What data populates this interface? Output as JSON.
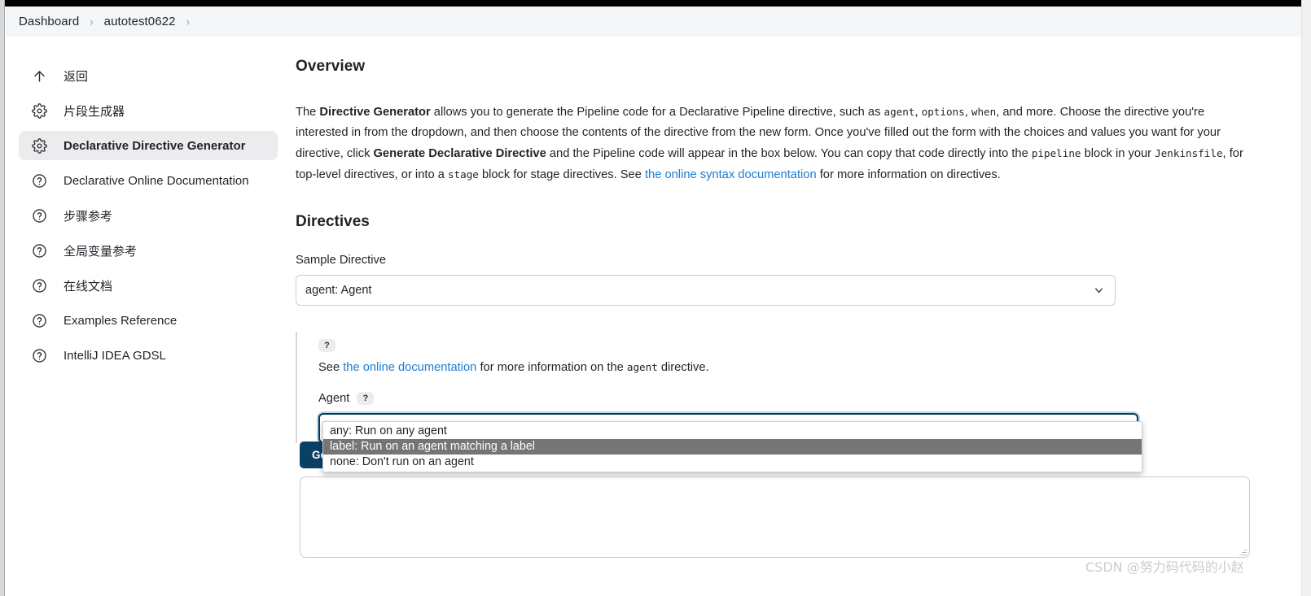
{
  "breadcrumb": {
    "items": [
      {
        "label": "Dashboard"
      },
      {
        "label": "autotest0622"
      }
    ],
    "separator": "›"
  },
  "sidebar": {
    "items": [
      {
        "label": "返回",
        "icon": "arrow-up-icon"
      },
      {
        "label": "片段生成器",
        "icon": "gear-icon"
      },
      {
        "label": "Declarative Directive Generator",
        "icon": "gear-icon",
        "active": true
      },
      {
        "label": "Declarative Online Documentation",
        "icon": "help-circle-icon"
      },
      {
        "label": "步骤参考",
        "icon": "help-circle-icon"
      },
      {
        "label": "全局变量参考",
        "icon": "help-circle-icon"
      },
      {
        "label": "在线文档",
        "icon": "help-circle-icon"
      },
      {
        "label": "Examples Reference",
        "icon": "help-circle-icon"
      },
      {
        "label": "IntelliJ IDEA GDSL",
        "icon": "help-circle-icon"
      }
    ]
  },
  "overview": {
    "heading": "Overview",
    "p1_a": "The ",
    "p1_b_directive_generator": "Directive Generator",
    "p1_c": " allows you to generate the Pipeline code for a Declarative Pipeline directive, such as ",
    "code_agent": "agent",
    "p1_d": ", ",
    "code_options": "options",
    "p1_e": ", ",
    "code_when": "when",
    "p1_f": ", and more. Choose the directive you're interested in from the dropdown, and then choose the contents of the directive from the new form. Once you've filled out the form with the choices and values you want for your directive, click ",
    "p1_b_generate": "Generate Declarative Directive",
    "p1_g": " and the Pipeline code will appear in the box below. You can copy that code directly into the ",
    "code_pipeline": "pipeline",
    "p1_h": " block in your ",
    "code_jenkinsfile": "Jenkinsfile",
    "p1_i": ", for top-level directives, or into a ",
    "code_stage": "stage",
    "p1_j": " block for stage directives. See ",
    "link_syntax_docs": "the online syntax documentation",
    "p1_k": " for more information on directives."
  },
  "directives": {
    "heading": "Directives",
    "sample_directive_label": "Sample Directive",
    "sample_directive_value": "agent: Agent",
    "help_badge": "?",
    "help_line_a": "See ",
    "help_link": "the online documentation",
    "help_line_b": " for more information on the ",
    "help_code_agent": "agent",
    "help_line_c": " directive.",
    "agent_label": "Agent",
    "agent_value": "any: Run on any agent",
    "agent_options": [
      {
        "label": "any: Run on any agent",
        "highlighted": false
      },
      {
        "label": "label: Run on an agent matching a label",
        "highlighted": true
      },
      {
        "label": "none: Don't run on an agent",
        "highlighted": false
      }
    ],
    "generate_button": "Generate Declarative Directive",
    "output_value": "",
    "output_placeholder": ""
  },
  "watermark": "CSDN @努力码代码的小赵",
  "colors": {
    "accent_link": "#1b7dd1",
    "primary_button": "#0b4066",
    "focus_ring": "#063a5e",
    "option_highlight": "#757575",
    "sidebar_active_bg": "#ececee"
  }
}
